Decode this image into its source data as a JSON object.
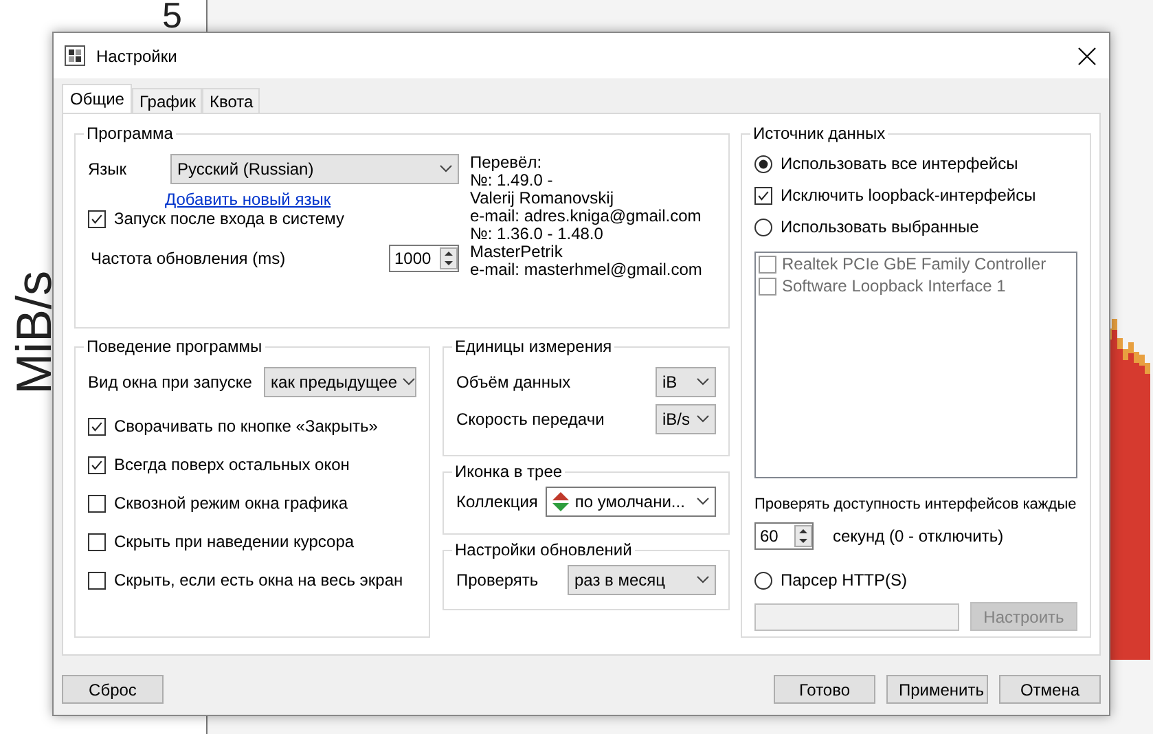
{
  "background": {
    "y_tick": "5",
    "axis_label": "MiB/s"
  },
  "window": {
    "title": "Настройки"
  },
  "tabs": [
    {
      "label": "Общие",
      "selected": true
    },
    {
      "label": "График",
      "selected": false
    },
    {
      "label": "Квота",
      "selected": false
    }
  ],
  "program": {
    "title": "Программа",
    "language_label": "Язык",
    "language_value": "Русский (Russian)",
    "add_language_link": "Добавить новый язык",
    "translators": [
      "Перевёл:",
      "№: 1.49.0 -",
      "Valerij Romanovskij",
      "e-mail: adres.kniga@gmail.com",
      "№: 1.36.0 - 1.48.0",
      "MasterPetrik",
      "e-mail: masterhmel@gmail.com"
    ],
    "autostart": {
      "label": "Запуск после входа в систему",
      "checked": true
    },
    "refresh_label": "Частота обновления (ms)",
    "refresh_value": "1000"
  },
  "behavior": {
    "title": "Поведение программы",
    "window_mode_label": "Вид окна при запуске",
    "window_mode_value": "как предыдущее",
    "options": [
      {
        "label": "Сворачивать по кнопке «Закрыть»",
        "checked": true
      },
      {
        "label": "Всегда поверх остальных окон",
        "checked": true
      },
      {
        "label": "Сквозной режим окна графика",
        "checked": false
      },
      {
        "label": "Скрыть при наведении курсора",
        "checked": false
      },
      {
        "label": "Скрыть, если есть окна на весь экран",
        "checked": false
      }
    ]
  },
  "units": {
    "title": "Единицы измерения",
    "rows": [
      {
        "label": "Объём данных",
        "value": "iB"
      },
      {
        "label": "Скорость передачи",
        "value": "iB/s"
      }
    ]
  },
  "tray_icon": {
    "title": "Иконка в трее",
    "collection_label": "Коллекция",
    "collection_value": "по умолчани..."
  },
  "updates": {
    "title": "Настройки обновлений",
    "check_label": "Проверять",
    "check_value": "раз в месяц"
  },
  "data_source": {
    "title": "Источник данных",
    "modes": [
      {
        "kind": "radio",
        "label": "Использовать все интерфейсы",
        "selected": true
      },
      {
        "kind": "checkbox",
        "label": "Исключить loopback-интерфейсы",
        "checked": true
      },
      {
        "kind": "radio",
        "label": "Использовать выбранные",
        "selected": false
      }
    ],
    "interfaces": {
      "disabled": true,
      "items": [
        {
          "label": "Realtek PCIe GbE Family Controller",
          "checked": false
        },
        {
          "label": "Software Loopback Interface 1",
          "checked": false
        }
      ]
    },
    "interval_label": "Проверять доступность интерфейсов каждые",
    "interval_value": "60",
    "interval_unit": "секунд (0 - отключить)",
    "http_parser": {
      "label": "Парсер HTTP(S)",
      "selected": false
    },
    "configure_button": {
      "label": "Настроить",
      "disabled": true
    }
  },
  "footer": {
    "reset": "Сброс",
    "buttons": [
      "Готово",
      "Применить",
      "Отмена"
    ]
  }
}
